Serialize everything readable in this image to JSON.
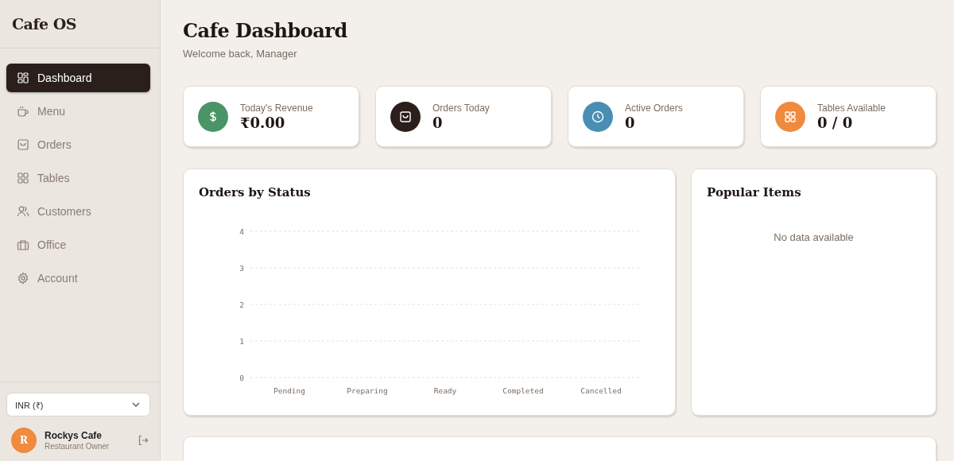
{
  "sidebar": {
    "brand": "Cafe OS",
    "items": [
      {
        "label": "Dashboard",
        "selected": true
      },
      {
        "label": "Menu",
        "selected": false
      },
      {
        "label": "Orders",
        "selected": false
      },
      {
        "label": "Tables",
        "selected": false
      },
      {
        "label": "Customers",
        "selected": false
      },
      {
        "label": "Office",
        "selected": false
      },
      {
        "label": "Account",
        "selected": false
      }
    ],
    "currency": {
      "value": "INR (₹)"
    },
    "user": {
      "initial": "R",
      "name": "Rockys Cafe",
      "role": "Restaurant Owner"
    }
  },
  "header": {
    "title": "Cafe Dashboard",
    "subtitle": "Welcome back, Manager"
  },
  "stats": [
    {
      "label": "Today's Revenue",
      "value": "₹0.00",
      "color": "#4a9467"
    },
    {
      "label": "Orders Today",
      "value": "0",
      "color": "#2a1f1a"
    },
    {
      "label": "Active Orders",
      "value": "0",
      "color": "#4a8fb3"
    },
    {
      "label": "Tables Available",
      "value": "0 / 0",
      "color": "#ef8a3e"
    }
  ],
  "orders_by_status": {
    "title": "Orders by Status",
    "chart_data": {
      "type": "bar",
      "categories": [
        "Pending",
        "Preparing",
        "Ready",
        "Completed",
        "Cancelled"
      ],
      "values": [
        0,
        0,
        0,
        0,
        0
      ],
      "ylim": [
        0,
        4
      ],
      "grid": true,
      "yticks": [
        0,
        1,
        2,
        3,
        4
      ]
    }
  },
  "popular_items": {
    "title": "Popular Items",
    "empty_text": "No data available"
  }
}
